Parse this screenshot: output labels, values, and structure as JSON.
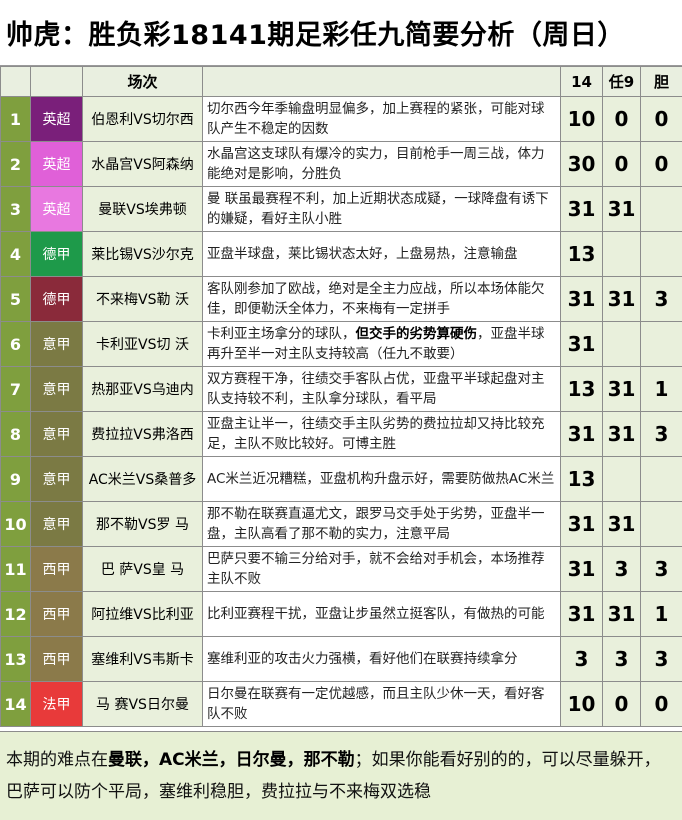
{
  "title": "帅虎：胜负彩18141期足彩任九简要分析（周日）",
  "header": {
    "index": "",
    "league": "",
    "match": "场次",
    "note": "",
    "pick14": "14",
    "pick9": "任9",
    "banker": "胆"
  },
  "rows": [
    {
      "n": "1",
      "league": "英超",
      "color": "#7a1f7a",
      "match": "伯恩利VS切尔西",
      "note_a": "切尔西今年季输盘明显偏多，加上赛程的紧张，可能对球队产生不稳定的因数",
      "note_b": "",
      "note_c": "",
      "p14": "10",
      "p9": "0",
      "banker": "0"
    },
    {
      "n": "2",
      "league": "英超",
      "color": "#e060d8",
      "match": "水晶宫VS阿森纳",
      "note_a": "水晶宫这支球队有爆冷的实力，目前枪手一周三战，体力能绝对是影响，分胜负",
      "note_b": "",
      "note_c": "",
      "p14": "30",
      "p9": "0",
      "banker": "0"
    },
    {
      "n": "3",
      "league": "英超",
      "color": "#e878e0",
      "match": "曼联VS埃弗顿",
      "note_a": "曼 联虽最赛程不利，加上近期状态成疑，一球降盘有诱下的嫌疑，看好主队小胜",
      "note_b": "",
      "note_c": "",
      "p14": "31",
      "p9": "31",
      "banker": ""
    },
    {
      "n": "4",
      "league": "德甲",
      "color": "#1e9a4a",
      "match": "莱比锡VS沙尔克",
      "note_a": "亚盘半球盘，莱比锡状态太好，上盘易热，注意输盘",
      "note_b": "",
      "note_c": "",
      "p14": "13",
      "p9": "",
      "banker": ""
    },
    {
      "n": "5",
      "league": "德甲",
      "color": "#8a2a3a",
      "match": "不来梅VS勒 沃",
      "note_a": "客队刚参加了欧战，绝对是全主力应战，所以本场体能欠佳，即便勒沃全体力，不来梅有一定拼手",
      "note_b": "",
      "note_c": "",
      "p14": "31",
      "p9": "31",
      "banker": "3"
    },
    {
      "n": "6",
      "league": "意甲",
      "color": "#7b7a44",
      "match": "卡利亚VS切 沃",
      "note_a": "卡利亚主场拿分的球队，",
      "note_b": "但交手的劣势算硬伤",
      "note_c": "，亚盘半球再升至半一对主队支持较高（任九不敢要）",
      "p14": "31",
      "p9": "",
      "banker": ""
    },
    {
      "n": "7",
      "league": "意甲",
      "color": "#7b7a44",
      "match": "热那亚VS乌迪内",
      "note_a": "双方赛程干净，往绩交手客队占优，亚盘平半球起盘对主队支持较不利，主队拿分球队，看平局",
      "note_b": "",
      "note_c": "",
      "p14": "13",
      "p9": "31",
      "banker": "1"
    },
    {
      "n": "8",
      "league": "意甲",
      "color": "#7b7a44",
      "match": "费拉拉VS弗洛西",
      "note_a": "亚盘主让半一，往绩交手主队劣势的费拉拉却又持比较充足，主队不败比较好。可博主胜",
      "note_b": "",
      "note_c": "",
      "p14": "31",
      "p9": "31",
      "banker": "3"
    },
    {
      "n": "9",
      "league": "意甲",
      "color": "#7b7a44",
      "match": "AC米兰VS桑普多",
      "note_a": "AC米兰近况糟糕，亚盘机构升盘示好，需要防做热AC米兰",
      "note_b": "",
      "note_c": "",
      "p14": "13",
      "p9": "",
      "banker": ""
    },
    {
      "n": "10",
      "league": "意甲",
      "color": "#7b7a44",
      "match": "那不勒VS罗 马",
      "note_a": "那不勒在联赛直逼尤文，跟罗马交手处于劣势，亚盘半一盘，主队高看了那不勒的实力，注意平局",
      "note_b": "",
      "note_c": "",
      "p14": "31",
      "p9": "31",
      "banker": ""
    },
    {
      "n": "11",
      "league": "西甲",
      "color": "#8b7a4a",
      "match": "巴 萨VS皇 马",
      "note_a": "巴萨只要不输三分给对手，就不会给对手机会，本场推荐主队不败",
      "note_b": "",
      "note_c": "",
      "p14": "31",
      "p9": "3",
      "banker": "3"
    },
    {
      "n": "12",
      "league": "西甲",
      "color": "#8b7a4a",
      "match": "阿拉维VS比利亚",
      "note_a": "比利亚赛程干扰，亚盘让步虽然立挺客队，有做热的可能",
      "note_b": "",
      "note_c": "",
      "p14": "31",
      "p9": "31",
      "banker": "1"
    },
    {
      "n": "13",
      "league": "西甲",
      "color": "#8b7a4a",
      "match": "塞维利VS韦斯卡",
      "note_a": "塞维利亚的攻击火力强横，看好他们在联赛持续拿分",
      "note_b": "",
      "note_c": "",
      "p14": "3",
      "p9": "3",
      "banker": "3"
    },
    {
      "n": "14",
      "league": "法甲",
      "color": "#e83a3a",
      "match": "马 赛VS日尔曼",
      "note_a": "日尔曼在联赛有一定优越感，而且主队少休一天，看好客队不败",
      "note_b": "",
      "note_c": "",
      "p14": "10",
      "p9": "0",
      "banker": "0"
    }
  ],
  "footer": {
    "t1": "本期的难点在",
    "e1": "曼联，AC米兰，日尔曼，那不勒",
    "t2": "；如果你能看好别的的，可以尽量躲开，巴萨可以防个平局，塞维利稳胆，费拉拉与不来梅双选稳"
  }
}
